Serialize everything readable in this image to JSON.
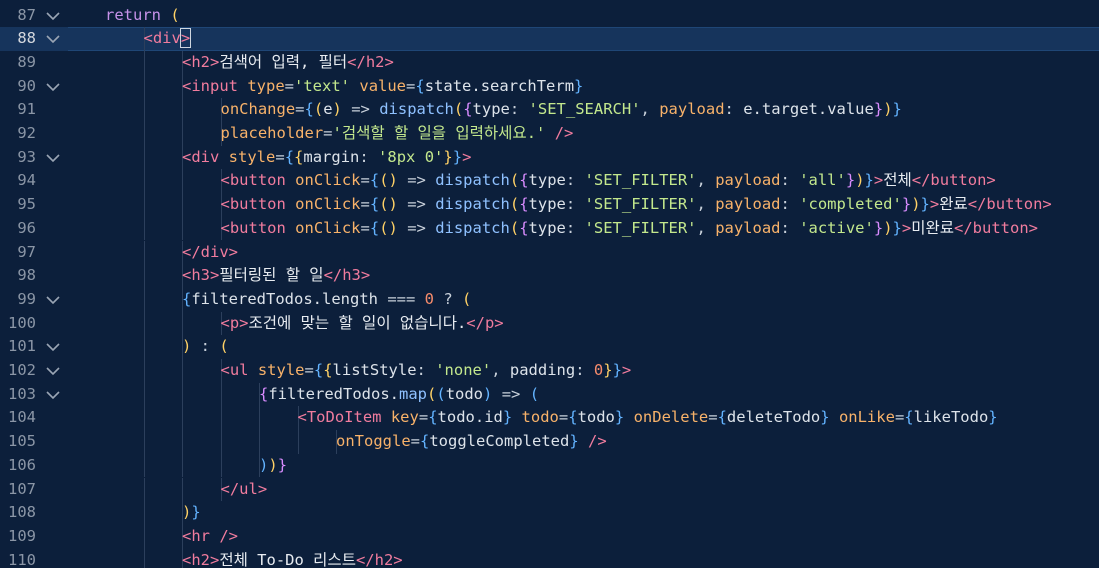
{
  "editor": {
    "theme_colors": {
      "background": "#0c1f3b",
      "active_line": "#16345c",
      "line_number": "#8b96a6",
      "tag": "#f17c9e",
      "attribute": "#f8b26a",
      "string": "#c3e88d",
      "function": "#8fc1ff",
      "number": "#f78c6c"
    },
    "active_line": 88,
    "lines": [
      {
        "num": "87",
        "fold": true,
        "indent": 1,
        "tokens": [
          [
            "kw",
            "return"
          ],
          [
            "punc",
            " "
          ],
          [
            "br1",
            "("
          ]
        ]
      },
      {
        "num": "88",
        "fold": true,
        "indent": 2,
        "tokens": [
          [
            "tag",
            "<div"
          ],
          [
            "tag",
            ">"
          ]
        ]
      },
      {
        "num": "89",
        "fold": false,
        "indent": 3,
        "tokens": [
          [
            "tag",
            "<h2>"
          ],
          [
            "text",
            "검색어 입력, 필터"
          ],
          [
            "tag",
            "</h2>"
          ]
        ]
      },
      {
        "num": "90",
        "fold": true,
        "indent": 3,
        "tokens": [
          [
            "tag",
            "<input"
          ],
          [
            "punc",
            " "
          ],
          [
            "attr",
            "type"
          ],
          [
            "punc",
            "="
          ],
          [
            "str",
            "'text'"
          ],
          [
            "punc",
            " "
          ],
          [
            "attr",
            "value"
          ],
          [
            "punc",
            "="
          ],
          [
            "br3",
            "{"
          ],
          [
            "var",
            "state.searchTerm"
          ],
          [
            "br3",
            "}"
          ]
        ]
      },
      {
        "num": "91",
        "fold": false,
        "indent": 4,
        "tokens": [
          [
            "attr",
            "onChange"
          ],
          [
            "punc",
            "="
          ],
          [
            "br3",
            "{"
          ],
          [
            "br1",
            "("
          ],
          [
            "var",
            "e"
          ],
          [
            "br1",
            ")"
          ],
          [
            "punc",
            " => "
          ],
          [
            "fn",
            "dispatch"
          ],
          [
            "br1",
            "("
          ],
          [
            "br2",
            "{"
          ],
          [
            "var",
            "type"
          ],
          [
            "punc",
            ": "
          ],
          [
            "str",
            "'SET_SEARCH'"
          ],
          [
            "punc",
            ", "
          ],
          [
            "attr",
            "payload"
          ],
          [
            "punc",
            ": "
          ],
          [
            "var",
            "e.target.value"
          ],
          [
            "br2",
            "}"
          ],
          [
            "br1",
            ")"
          ],
          [
            "br3",
            "}"
          ]
        ]
      },
      {
        "num": "92",
        "fold": false,
        "indent": 4,
        "tokens": [
          [
            "attr",
            "placeholder"
          ],
          [
            "punc",
            "="
          ],
          [
            "str",
            "'검색할 할 일을 입력하세요.'"
          ],
          [
            "punc",
            " "
          ],
          [
            "tag",
            "/>"
          ]
        ]
      },
      {
        "num": "93",
        "fold": true,
        "indent": 3,
        "tokens": [
          [
            "tag",
            "<div"
          ],
          [
            "punc",
            " "
          ],
          [
            "attr",
            "style"
          ],
          [
            "punc",
            "="
          ],
          [
            "br3",
            "{"
          ],
          [
            "br1",
            "{"
          ],
          [
            "var",
            "margin"
          ],
          [
            "punc",
            ": "
          ],
          [
            "str",
            "'8px 0'"
          ],
          [
            "br1",
            "}"
          ],
          [
            "br3",
            "}"
          ],
          [
            "tag",
            ">"
          ]
        ]
      },
      {
        "num": "94",
        "fold": false,
        "indent": 4,
        "tokens": [
          [
            "tag",
            "<button"
          ],
          [
            "punc",
            " "
          ],
          [
            "attr",
            "onClick"
          ],
          [
            "punc",
            "="
          ],
          [
            "br3",
            "{"
          ],
          [
            "br1",
            "()"
          ],
          [
            "punc",
            " => "
          ],
          [
            "fn",
            "dispatch"
          ],
          [
            "br1",
            "("
          ],
          [
            "br2",
            "{"
          ],
          [
            "var",
            "type"
          ],
          [
            "punc",
            ": "
          ],
          [
            "str",
            "'SET_FILTER'"
          ],
          [
            "punc",
            ", "
          ],
          [
            "attr",
            "payload"
          ],
          [
            "punc",
            ": "
          ],
          [
            "str",
            "'all'"
          ],
          [
            "br2",
            "}"
          ],
          [
            "br1",
            ")"
          ],
          [
            "br3",
            "}"
          ],
          [
            "tag",
            ">"
          ],
          [
            "text",
            "전체"
          ],
          [
            "tag",
            "</button>"
          ]
        ]
      },
      {
        "num": "95",
        "fold": false,
        "indent": 4,
        "tokens": [
          [
            "tag",
            "<button"
          ],
          [
            "punc",
            " "
          ],
          [
            "attr",
            "onClick"
          ],
          [
            "punc",
            "="
          ],
          [
            "br3",
            "{"
          ],
          [
            "br1",
            "()"
          ],
          [
            "punc",
            " => "
          ],
          [
            "fn",
            "dispatch"
          ],
          [
            "br1",
            "("
          ],
          [
            "br2",
            "{"
          ],
          [
            "var",
            "type"
          ],
          [
            "punc",
            ": "
          ],
          [
            "str",
            "'SET_FILTER'"
          ],
          [
            "punc",
            ", "
          ],
          [
            "attr",
            "payload"
          ],
          [
            "punc",
            ": "
          ],
          [
            "str",
            "'completed'"
          ],
          [
            "br2",
            "}"
          ],
          [
            "br1",
            ")"
          ],
          [
            "br3",
            "}"
          ],
          [
            "tag",
            ">"
          ],
          [
            "text",
            "완료"
          ],
          [
            "tag",
            "</button>"
          ]
        ]
      },
      {
        "num": "96",
        "fold": false,
        "indent": 4,
        "tokens": [
          [
            "tag",
            "<button"
          ],
          [
            "punc",
            " "
          ],
          [
            "attr",
            "onClick"
          ],
          [
            "punc",
            "="
          ],
          [
            "br3",
            "{"
          ],
          [
            "br1",
            "()"
          ],
          [
            "punc",
            " => "
          ],
          [
            "fn",
            "dispatch"
          ],
          [
            "br1",
            "("
          ],
          [
            "br2",
            "{"
          ],
          [
            "var",
            "type"
          ],
          [
            "punc",
            ": "
          ],
          [
            "str",
            "'SET_FILTER'"
          ],
          [
            "punc",
            ", "
          ],
          [
            "attr",
            "payload"
          ],
          [
            "punc",
            ": "
          ],
          [
            "str",
            "'active'"
          ],
          [
            "br2",
            "}"
          ],
          [
            "br1",
            ")"
          ],
          [
            "br3",
            "}"
          ],
          [
            "tag",
            ">"
          ],
          [
            "text",
            "미완료"
          ],
          [
            "tag",
            "</button>"
          ]
        ]
      },
      {
        "num": "97",
        "fold": false,
        "indent": 3,
        "tokens": [
          [
            "tag",
            "</div>"
          ]
        ]
      },
      {
        "num": "98",
        "fold": false,
        "indent": 3,
        "tokens": [
          [
            "tag",
            "<h3>"
          ],
          [
            "text",
            "필터링된 할 일"
          ],
          [
            "tag",
            "</h3>"
          ]
        ]
      },
      {
        "num": "99",
        "fold": true,
        "indent": 3,
        "tokens": [
          [
            "br3",
            "{"
          ],
          [
            "var",
            "filteredTodos.length"
          ],
          [
            "punc",
            " === "
          ],
          [
            "num",
            "0"
          ],
          [
            "punc",
            " ? "
          ],
          [
            "br1",
            "("
          ]
        ]
      },
      {
        "num": "100",
        "fold": false,
        "indent": 4,
        "tokens": [
          [
            "tag",
            "<p>"
          ],
          [
            "text",
            "조건에 맞는 할 일이 없습니다."
          ],
          [
            "tag",
            "</p>"
          ]
        ]
      },
      {
        "num": "101",
        "fold": true,
        "indent": 3,
        "tokens": [
          [
            "br1",
            ")"
          ],
          [
            "punc",
            " : "
          ],
          [
            "br1",
            "("
          ]
        ]
      },
      {
        "num": "102",
        "fold": true,
        "indent": 4,
        "tokens": [
          [
            "tag",
            "<ul"
          ],
          [
            "punc",
            " "
          ],
          [
            "attr",
            "style"
          ],
          [
            "punc",
            "="
          ],
          [
            "br3",
            "{"
          ],
          [
            "br1",
            "{"
          ],
          [
            "var",
            "listStyle"
          ],
          [
            "punc",
            ": "
          ],
          [
            "str",
            "'none'"
          ],
          [
            "punc",
            ", "
          ],
          [
            "var",
            "padding"
          ],
          [
            "punc",
            ": "
          ],
          [
            "num",
            "0"
          ],
          [
            "br1",
            "}"
          ],
          [
            "br3",
            "}"
          ],
          [
            "tag",
            ">"
          ]
        ]
      },
      {
        "num": "103",
        "fold": true,
        "indent": 5,
        "tokens": [
          [
            "br2",
            "{"
          ],
          [
            "var",
            "filteredTodos."
          ],
          [
            "fn",
            "map"
          ],
          [
            "br1",
            "("
          ],
          [
            "br3",
            "("
          ],
          [
            "var",
            "todo"
          ],
          [
            "br3",
            ")"
          ],
          [
            "punc",
            " => "
          ],
          [
            "br3",
            "("
          ]
        ]
      },
      {
        "num": "104",
        "fold": false,
        "indent": 6,
        "tokens": [
          [
            "tag",
            "<ToDoItem"
          ],
          [
            "punc",
            " "
          ],
          [
            "attr",
            "key"
          ],
          [
            "punc",
            "="
          ],
          [
            "br3",
            "{"
          ],
          [
            "var",
            "todo.id"
          ],
          [
            "br3",
            "}"
          ],
          [
            "punc",
            " "
          ],
          [
            "attr",
            "todo"
          ],
          [
            "punc",
            "="
          ],
          [
            "br3",
            "{"
          ],
          [
            "var",
            "todo"
          ],
          [
            "br3",
            "}"
          ],
          [
            "punc",
            " "
          ],
          [
            "attr",
            "onDelete"
          ],
          [
            "punc",
            "="
          ],
          [
            "br3",
            "{"
          ],
          [
            "var",
            "deleteTodo"
          ],
          [
            "br3",
            "}"
          ],
          [
            "punc",
            " "
          ],
          [
            "attr",
            "onLike"
          ],
          [
            "punc",
            "="
          ],
          [
            "br3",
            "{"
          ],
          [
            "var",
            "likeTodo"
          ],
          [
            "br3",
            "}"
          ]
        ]
      },
      {
        "num": "105",
        "fold": false,
        "indent": 7,
        "tokens": [
          [
            "attr",
            "onToggle"
          ],
          [
            "punc",
            "="
          ],
          [
            "br3",
            "{"
          ],
          [
            "var",
            "toggleCompleted"
          ],
          [
            "br3",
            "}"
          ],
          [
            "punc",
            " "
          ],
          [
            "tag",
            "/>"
          ]
        ]
      },
      {
        "num": "106",
        "fold": false,
        "indent": 5,
        "tokens": [
          [
            "br3",
            ")"
          ],
          [
            "br1",
            ")"
          ],
          [
            "br2",
            "}"
          ]
        ]
      },
      {
        "num": "107",
        "fold": false,
        "indent": 4,
        "tokens": [
          [
            "tag",
            "</ul>"
          ]
        ]
      },
      {
        "num": "108",
        "fold": false,
        "indent": 3,
        "tokens": [
          [
            "br1",
            ")"
          ],
          [
            "br3",
            "}"
          ]
        ]
      },
      {
        "num": "109",
        "fold": false,
        "indent": 3,
        "tokens": [
          [
            "tag",
            "<hr"
          ],
          [
            "punc",
            " "
          ],
          [
            "tag",
            "/>"
          ]
        ]
      },
      {
        "num": "110",
        "fold": false,
        "indent": 3,
        "tokens": [
          [
            "tag",
            "<h2>"
          ],
          [
            "text",
            "전체 To-Do 리스트"
          ],
          [
            "tag",
            "</h2>"
          ]
        ]
      }
    ]
  }
}
